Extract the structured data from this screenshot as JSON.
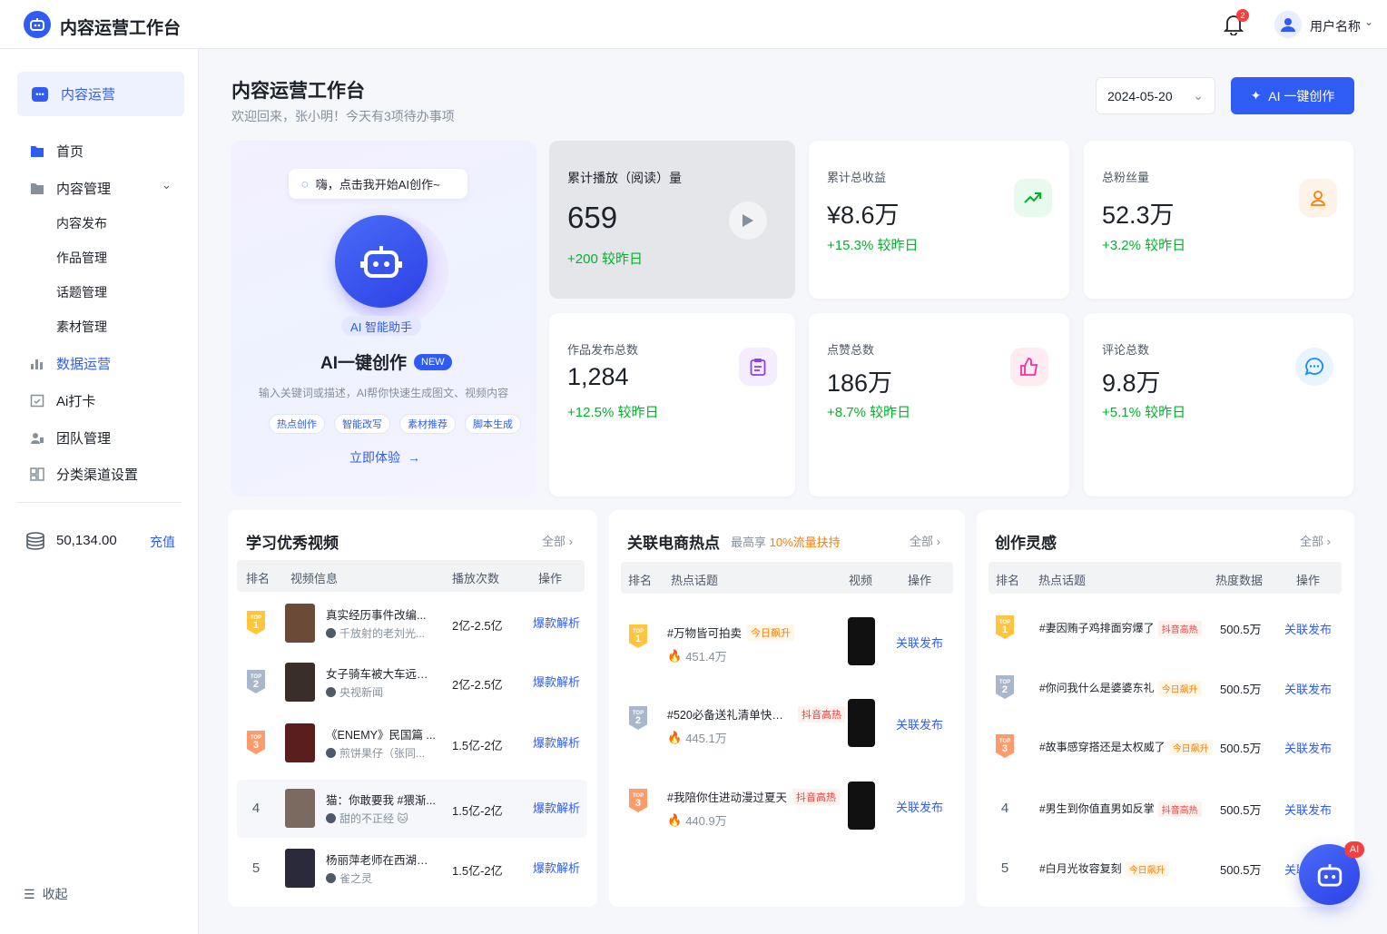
{
  "app": {
    "title": "内容运营工作台",
    "notification_count": "2",
    "user_name": "用户名称"
  },
  "sidebar": {
    "active": "内容运营",
    "items": [
      {
        "label": "首页"
      },
      {
        "label": "内容管理"
      },
      {
        "label": "内容发布"
      },
      {
        "label": "作品管理"
      },
      {
        "label": "话题管理"
      },
      {
        "label": "素材管理"
      },
      {
        "label": "数据运营"
      },
      {
        "label": "Ai打卡"
      },
      {
        "label": "团队管理"
      },
      {
        "label": "分类渠道设置"
      }
    ],
    "balance": "50,134.00",
    "recharge": "充值",
    "collapse": "收起"
  },
  "header": {
    "title": "内容运营工作台",
    "subtitle": "欢迎回来，张小明！今天有3项待办事项",
    "date": "2024-05-20",
    "ai_button": "AI 一键创作"
  },
  "ai_card": {
    "bubble": "嗨，点击我开始AI创作~",
    "tag": "AI 智能助手",
    "title": "AI一键创作",
    "new": "NEW",
    "desc": "输入关键词或描述，AI帮你快速生成图文、视频内容",
    "chips": [
      "热点创作",
      "智能改写",
      "素材推荐",
      "脚本生成"
    ],
    "try": "立即体验"
  },
  "stats": [
    {
      "label": "累计播放（阅读）量",
      "value": "659",
      "change": "+200  较昨日"
    },
    {
      "label": "累计总收益",
      "value": "¥8.6万",
      "change": "+15.3%  较昨日"
    },
    {
      "label": "总粉丝量",
      "value": "52.3万",
      "change": "+3.2%  较昨日"
    },
    {
      "label": "作品发布总数",
      "value": "1,284",
      "change": "+12.5%  较昨日"
    },
    {
      "label": "点赞总数",
      "value": "186万",
      "change": "+8.7%  较昨日"
    },
    {
      "label": "评论总数",
      "value": "9.8万",
      "change": "+5.1%  较昨日"
    }
  ],
  "videos": {
    "title": "学习优秀视频",
    "more": "全部",
    "columns": [
      "排名",
      "视频信息",
      "播放次数",
      "操作"
    ],
    "rows": [
      {
        "rank": "1",
        "title": "真实经历事件改编...",
        "author": "千放射的老刘光...",
        "plays": "2亿-2.5亿",
        "action": "爆款解析"
      },
      {
        "rank": "2",
        "title": "女子骑车被大车远光...",
        "author": "央视新闻",
        "plays": "2亿-2.5亿",
        "action": "爆款解析"
      },
      {
        "rank": "3",
        "title": "《ENEMY》民国篇 ...",
        "author": "煎饼果仔（张同...",
        "plays": "1.5亿-2亿",
        "action": "爆款解析"
      },
      {
        "rank": "4",
        "title": "猫：你敢要我 #猥渐...",
        "author": "甜的不正经 🐱",
        "plays": "1.5亿-2亿",
        "action": "爆款解析"
      },
      {
        "rank": "5",
        "title": "杨丽萍老师在西湖边...",
        "author": "雀之灵",
        "plays": "1.5亿-2亿",
        "action": "爆款解析"
      }
    ]
  },
  "ecom": {
    "title": "关联电商热点",
    "hint_prefix": "最高享",
    "hint_highlight": "10%流量扶持",
    "more": "全部",
    "columns": [
      "排名",
      "热点话题",
      "视频",
      "操作"
    ],
    "rows": [
      {
        "rank": "1",
        "topic": "#万物皆可拍卖",
        "tag": "今日飙升",
        "heat": "451.4万",
        "action": "关联发布"
      },
      {
        "rank": "2",
        "topic": "#520必备送礼清单快来...",
        "tag": "抖音高热",
        "heat": "445.1万",
        "action": "关联发布"
      },
      {
        "rank": "3",
        "topic": "#我陪你住进动漫过夏天",
        "tag": "抖音高热",
        "heat": "440.9万",
        "action": "关联发布"
      }
    ]
  },
  "inspire": {
    "title": "创作灵感",
    "more": "全部",
    "columns": [
      "排名",
      "热点话题",
      "热度数据",
      "操作"
    ],
    "rows": [
      {
        "rank": "1",
        "topic": "#妻因贿子鸡排面穷爆了",
        "tag": "抖音高热",
        "heat": "500.5万",
        "action": "关联发布"
      },
      {
        "rank": "2",
        "topic": "#你问我什么是婆婆东礼",
        "tag": "今日飙升",
        "heat": "500.5万",
        "action": "关联发布"
      },
      {
        "rank": "3",
        "topic": "#故事感穿搭还是太权威了",
        "tag": "今日飙升",
        "heat": "500.5万",
        "action": "关联发布"
      },
      {
        "rank": "4",
        "topic": "#男生到你值直男如反掌",
        "tag": "抖音高热",
        "heat": "500.5万",
        "action": "关联发布"
      },
      {
        "rank": "5",
        "topic": "#白月光妆容复刻",
        "tag": "今日飙升",
        "heat": "500.5万",
        "action": "关联发布"
      }
    ]
  },
  "fab": {
    "badge": "AI"
  }
}
